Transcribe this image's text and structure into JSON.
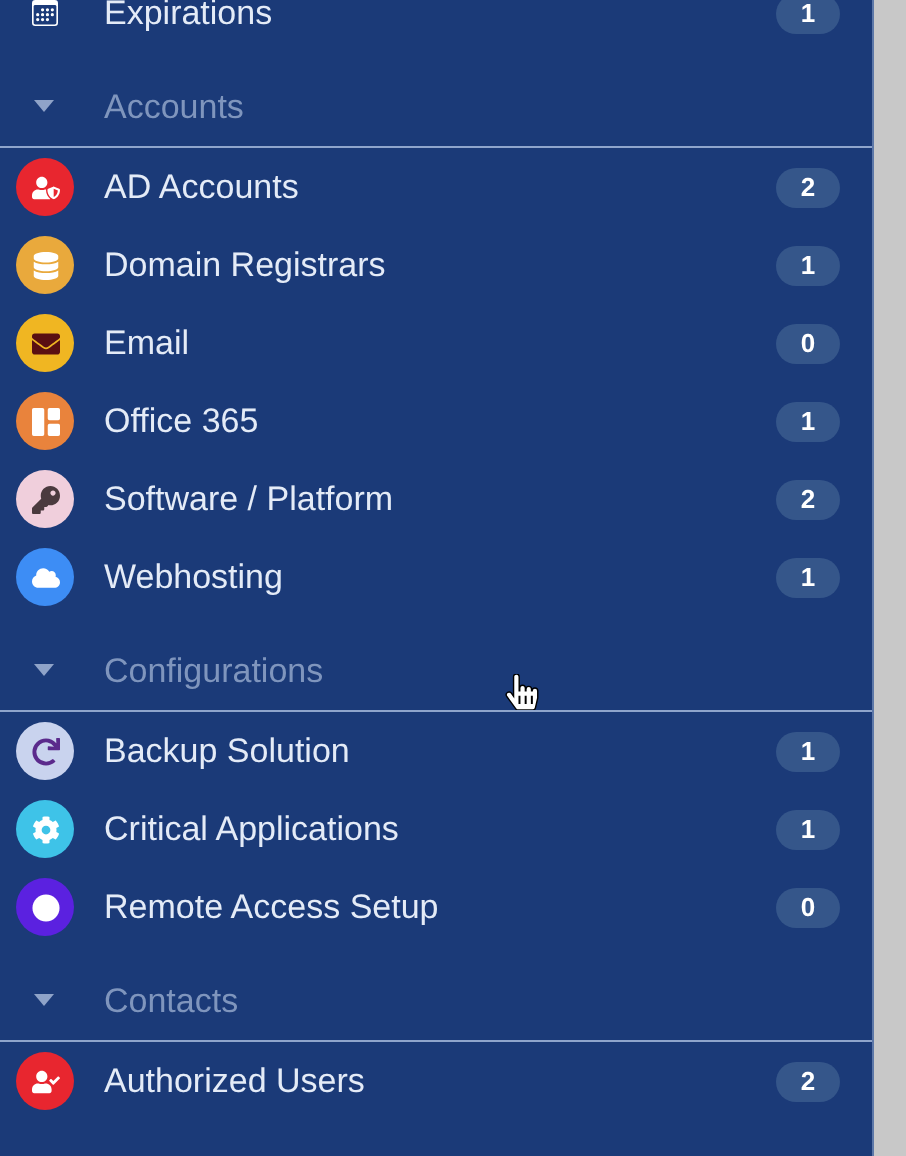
{
  "sidebar": {
    "top_items": [
      {
        "label": "Expirations",
        "count": "1"
      }
    ],
    "groups": [
      {
        "title": "Accounts",
        "expanded": true,
        "items": [
          {
            "label": "AD Accounts",
            "count": "2",
            "color": "#e8262f"
          },
          {
            "label": "Domain Registrars",
            "count": "1",
            "color": "#e9a93c"
          },
          {
            "label": "Email",
            "count": "0",
            "color": "#f0b622"
          },
          {
            "label": "Office 365",
            "count": "1",
            "color": "#e9833c"
          },
          {
            "label": "Software / Platform",
            "count": "2",
            "color": "#f0cfdc"
          },
          {
            "label": "Webhosting",
            "count": "1",
            "color": "#3d8df5"
          }
        ]
      },
      {
        "title": "Configurations",
        "expanded": true,
        "items": [
          {
            "label": "Backup Solution",
            "count": "1",
            "color": "#c9d3ee"
          },
          {
            "label": "Critical Applications",
            "count": "1",
            "color": "#3ec3e8"
          },
          {
            "label": "Remote Access Setup",
            "count": "0",
            "color": "#5b21e0"
          }
        ]
      },
      {
        "title": "Contacts",
        "expanded": true,
        "items": [
          {
            "label": "Authorized Users",
            "count": "2",
            "color": "#e8262f"
          }
        ]
      }
    ]
  }
}
